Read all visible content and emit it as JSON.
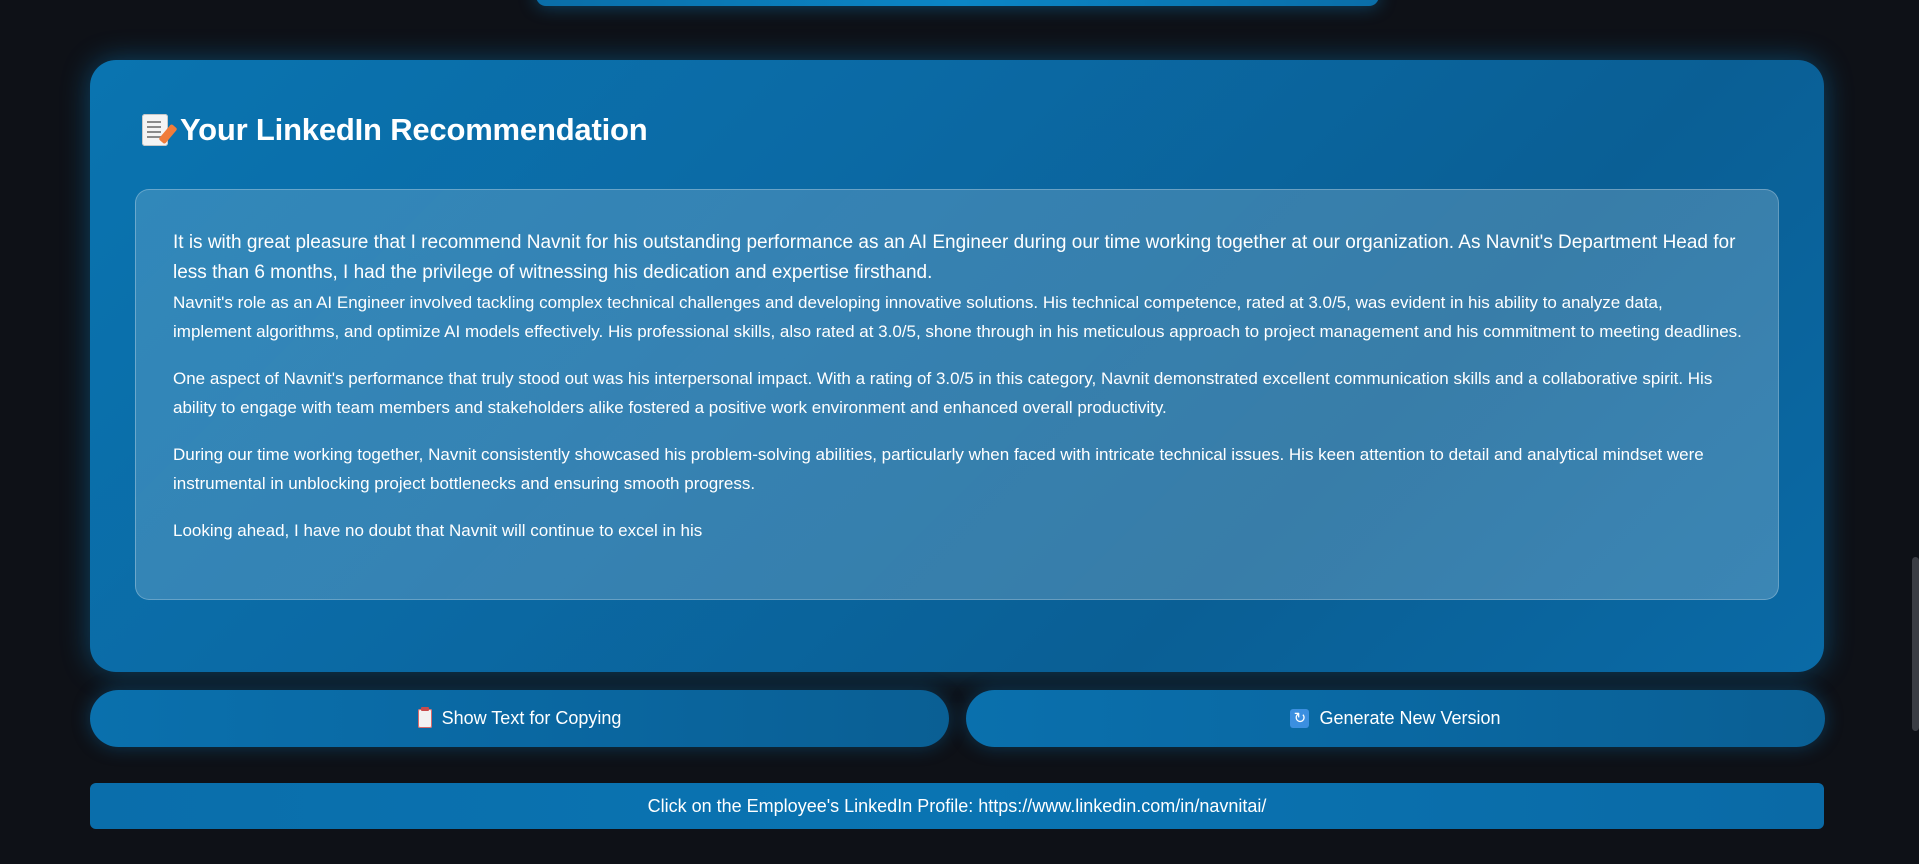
{
  "recommendation": {
    "title": "Your LinkedIn Recommendation",
    "paragraphs": [
      "It is with great pleasure that I recommend Navnit for his outstanding performance as an AI Engineer during our time working together at our organization. As Navnit's Department Head for less than 6 months, I had the privilege of witnessing his dedication and expertise firsthand.",
      "Navnit's role as an AI Engineer involved tackling complex technical challenges and developing innovative solutions. His technical competence, rated at 3.0/5, was evident in his ability to analyze data, implement algorithms, and optimize AI models effectively. His professional skills, also rated at 3.0/5, shone through in his meticulous approach to project management and his commitment to meeting deadlines.",
      "One aspect of Navnit's performance that truly stood out was his interpersonal impact. With a rating of 3.0/5 in this category, Navnit demonstrated excellent communication skills and a collaborative spirit. His ability to engage with team members and stakeholders alike fostered a positive work environment and enhanced overall productivity.",
      "During our time working together, Navnit consistently showcased his problem-solving abilities, particularly when faced with intricate technical issues. His keen attention to detail and analytical mindset were instrumental in unblocking project bottlenecks and ensuring smooth progress.",
      "Looking ahead, I have no doubt that Navnit will continue to excel in his"
    ]
  },
  "actions": {
    "copy_label": "Show Text for Copying",
    "regenerate_label": "Generate New Version"
  },
  "profile_link": {
    "text": "Click on the Employee's LinkedIn Profile: https://www.linkedin.com/in/navnitai/"
  },
  "icons": {
    "title_icon": "memo-icon",
    "copy_icon": "clipboard-icon",
    "regenerate_icon": "refresh-icon"
  },
  "colors": {
    "background": "#0e1117",
    "accent": "#0a6ea8"
  }
}
